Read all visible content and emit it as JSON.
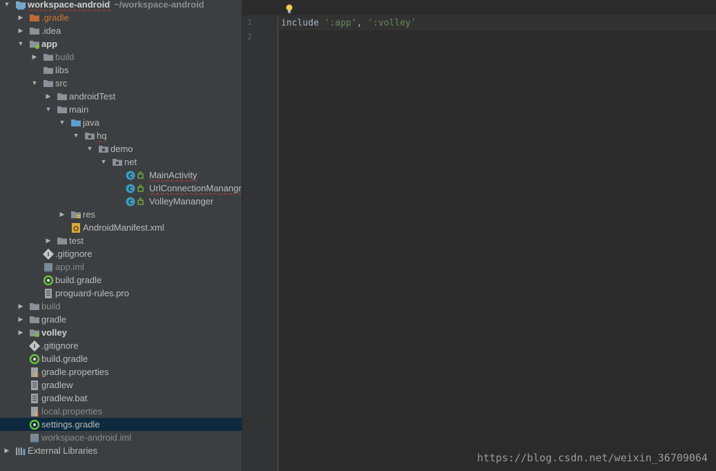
{
  "project_tree": {
    "rows": [
      {
        "depth": 0,
        "arrow": "down",
        "icon": "project-module-icon",
        "label": "workspace-android",
        "style": "bold",
        "squiggle": true,
        "sub": "~/workspace-android"
      },
      {
        "depth": 1,
        "arrow": "right",
        "icon": "excluded-folder-icon",
        "label": ".gradle",
        "style": "excluded"
      },
      {
        "depth": 1,
        "arrow": "right",
        "icon": "folder-icon",
        "label": ".idea"
      },
      {
        "depth": 1,
        "arrow": "down",
        "icon": "module-folder-icon",
        "label": "app",
        "style": "bold"
      },
      {
        "depth": 2,
        "arrow": "right",
        "icon": "folder-icon",
        "label": "build",
        "style": "dim"
      },
      {
        "depth": 2,
        "arrow": "none",
        "icon": "folder-icon",
        "label": "libs"
      },
      {
        "depth": 2,
        "arrow": "down",
        "icon": "folder-icon",
        "label": "src"
      },
      {
        "depth": 3,
        "arrow": "right",
        "icon": "folder-icon",
        "label": "androidTest"
      },
      {
        "depth": 3,
        "arrow": "down",
        "icon": "folder-icon",
        "label": "main"
      },
      {
        "depth": 4,
        "arrow": "down",
        "icon": "source-folder-icon",
        "label": "java"
      },
      {
        "depth": 5,
        "arrow": "down",
        "icon": "package-icon",
        "label": "hq",
        "squiggle": true
      },
      {
        "depth": 6,
        "arrow": "down",
        "icon": "package-icon",
        "label": "demo"
      },
      {
        "depth": 7,
        "arrow": "down",
        "icon": "package-icon",
        "label": "net"
      },
      {
        "depth": 8,
        "arrow": "none",
        "icon": "java-class-icon",
        "label": "MainActivity",
        "squiggle": true
      },
      {
        "depth": 8,
        "arrow": "none",
        "icon": "java-class-icon",
        "label": "UrlConnectionManangr",
        "squiggle": true
      },
      {
        "depth": 8,
        "arrow": "none",
        "icon": "java-class-icon",
        "label": "VolleyMananger"
      },
      {
        "depth": 4,
        "arrow": "right",
        "icon": "resource-folder-icon",
        "label": "res"
      },
      {
        "depth": 4,
        "arrow": "none",
        "icon": "manifest-file-icon",
        "label": "AndroidManifest.xml"
      },
      {
        "depth": 3,
        "arrow": "right",
        "icon": "folder-icon",
        "label": "test"
      },
      {
        "depth": 2,
        "arrow": "none",
        "icon": "gitignore-file-icon",
        "label": ".gitignore"
      },
      {
        "depth": 2,
        "arrow": "none",
        "icon": "iml-file-icon",
        "label": "app.iml",
        "style": "dim"
      },
      {
        "depth": 2,
        "arrow": "none",
        "icon": "gradle-file-icon",
        "label": "build.gradle"
      },
      {
        "depth": 2,
        "arrow": "none",
        "icon": "text-file-icon",
        "label": "proguard-rules.pro"
      },
      {
        "depth": 1,
        "arrow": "right",
        "icon": "folder-icon",
        "label": "build",
        "style": "dim"
      },
      {
        "depth": 1,
        "arrow": "right",
        "icon": "folder-icon",
        "label": "gradle"
      },
      {
        "depth": 1,
        "arrow": "right",
        "icon": "library-module-icon",
        "label": "volley",
        "style": "bold"
      },
      {
        "depth": 1,
        "arrow": "none",
        "icon": "gitignore-file-icon",
        "label": ".gitignore"
      },
      {
        "depth": 1,
        "arrow": "none",
        "icon": "gradle-file-icon",
        "label": "build.gradle"
      },
      {
        "depth": 1,
        "arrow": "none",
        "icon": "properties-file-icon",
        "label": "gradle.properties"
      },
      {
        "depth": 1,
        "arrow": "none",
        "icon": "text-file-icon",
        "label": "gradlew"
      },
      {
        "depth": 1,
        "arrow": "none",
        "icon": "text-file-icon",
        "label": "gradlew.bat"
      },
      {
        "depth": 1,
        "arrow": "none",
        "icon": "properties-file-icon",
        "label": "local.properties",
        "style": "dim"
      },
      {
        "depth": 1,
        "arrow": "none",
        "icon": "gradle-file-icon",
        "label": "settings.gradle",
        "selected": true
      },
      {
        "depth": 1,
        "arrow": "none",
        "icon": "iml-file-icon",
        "label": "workspace-android.iml",
        "style": "dim"
      },
      {
        "depth": 0,
        "arrow": "right",
        "icon": "external-libraries-icon",
        "label": "External Libraries"
      }
    ]
  },
  "editor": {
    "line_numbers": [
      "1",
      "2"
    ],
    "lines": [
      {
        "tokens": [
          {
            "t": "include",
            "c": "plain"
          },
          {
            "t": " ",
            "c": "plain"
          },
          {
            "t": "':app'",
            "c": "str"
          },
          {
            "t": ", ",
            "c": "plain"
          },
          {
            "t": "':volley'",
            "c": "str"
          }
        ]
      },
      {
        "tokens": []
      }
    ],
    "intention_icon": "lightbulb-icon"
  },
  "watermark": "https://blog.csdn.net/weixin_36709064",
  "colors": {
    "folder": "#8a9199",
    "source_folder": "#5c9fd1",
    "excluded_folder": "#c06a3a",
    "class_circle": "#3d9bbf",
    "gradle": "#67c23a",
    "keyword": "#cc7832",
    "string": "#6a8759"
  }
}
